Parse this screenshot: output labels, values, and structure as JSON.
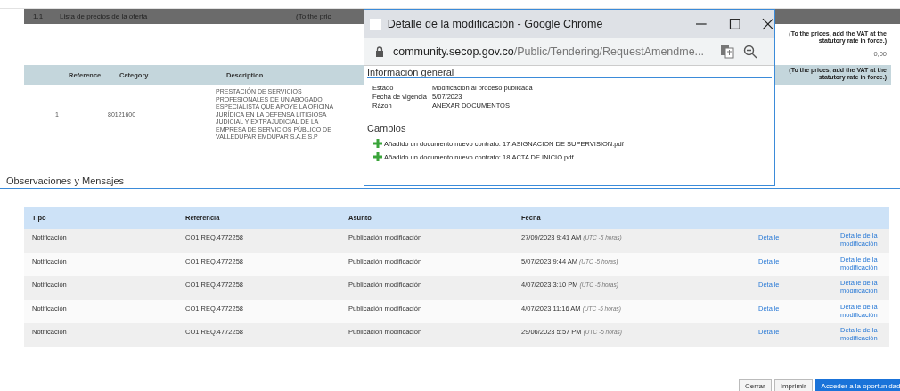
{
  "price_list": {
    "number": "1.1",
    "title": "Lista de precios de la oferta",
    "note": "(To the pric"
  },
  "vat_note": "(To the prices, add the VAT at the statutory rate in force.)",
  "total": "0,00",
  "items_table": {
    "columns": [
      "Reference",
      "Category",
      "Description"
    ],
    "header_note": "(To the prices, add the VAT at the statutory rate in force.)",
    "rows": [
      {
        "reference": "1",
        "category": "80121600",
        "description": "PRESTACIÓN DE SERVICIOS PROFESIONALES DE UN ABOGADO ESPECIALISTA QUE APOYE LA OFICINA JURÍDICA EN LA DEFENSA LITIGIOSA JUDICIAL Y EXTRAJUDICIAL DE LA EMPRESA DE SERVICIOS PÚBLICO DE VALLEDUPAR EMDUPAR S.A.E.S.P"
      }
    ]
  },
  "section_title": "Observaciones y Mensajes",
  "messages": {
    "columns": [
      "Tipo",
      "Referencia",
      "Asunto",
      "Fecha"
    ],
    "rows": [
      {
        "tipo": "Notificación",
        "referencia": "CO1.REQ.4772258",
        "asunto": "Publicación modificación",
        "fecha": "27/09/2023 9:41 AM",
        "zona": "(UTC -5 horas)",
        "detalle": "Detalle",
        "modificacion": "Detalle de la modificación"
      },
      {
        "tipo": "Notificación",
        "referencia": "CO1.REQ.4772258",
        "asunto": "Publicación modificación",
        "fecha": "5/07/2023 9:44 AM",
        "zona": "(UTC -5 horas)",
        "detalle": "Detalle",
        "modificacion": "Detalle de la modificación"
      },
      {
        "tipo": "Notificación",
        "referencia": "CO1.REQ.4772258",
        "asunto": "Publicación modificación",
        "fecha": "4/07/2023 3:10 PM",
        "zona": "(UTC -5 horas)",
        "detalle": "Detalle",
        "modificacion": "Detalle de la modificación"
      },
      {
        "tipo": "Notificación",
        "referencia": "CO1.REQ.4772258",
        "asunto": "Publicación modificación",
        "fecha": "4/07/2023 11:16 AM",
        "zona": "(UTC -5 horas)",
        "detalle": "Detalle",
        "modificacion": "Detalle de la modificación"
      },
      {
        "tipo": "Notificación",
        "referencia": "CO1.REQ.4772258",
        "asunto": "Publicación modificación",
        "fecha": "29/06/2023 5:57 PM",
        "zona": "(UTC -5 horas)",
        "detalle": "Detalle",
        "modificacion": "Detalle de la modificación"
      }
    ]
  },
  "buttons": [
    {
      "label": "Cerrar",
      "kind": "secondary"
    },
    {
      "label": "Imprimir",
      "kind": "secondary"
    },
    {
      "label": "Acceder a la oportunidad",
      "kind": "primary"
    }
  ],
  "popup": {
    "title": "Detalle de la modificación - Google Chrome",
    "url_host": "community.secop.gov.co",
    "url_path": "/Public/Tendering/RequestAmendme...",
    "general_title": "Información general",
    "fields": [
      {
        "label": "Estado",
        "value": "Modificación al proceso publicada"
      },
      {
        "label": "Fecha de vigencia",
        "value": "5/07/2023"
      },
      {
        "label": "Rázon",
        "value": "ANEXAR DOCUMENTOS"
      }
    ],
    "changes_title": "Cambios",
    "changes": [
      "Añadido un documento nuevo contrato: 17.ASIGNACION DE SUPERVISION.pdf",
      "Añadido un documento nuevo contrato: 18.ACTA DE INICIO.pdf"
    ]
  }
}
